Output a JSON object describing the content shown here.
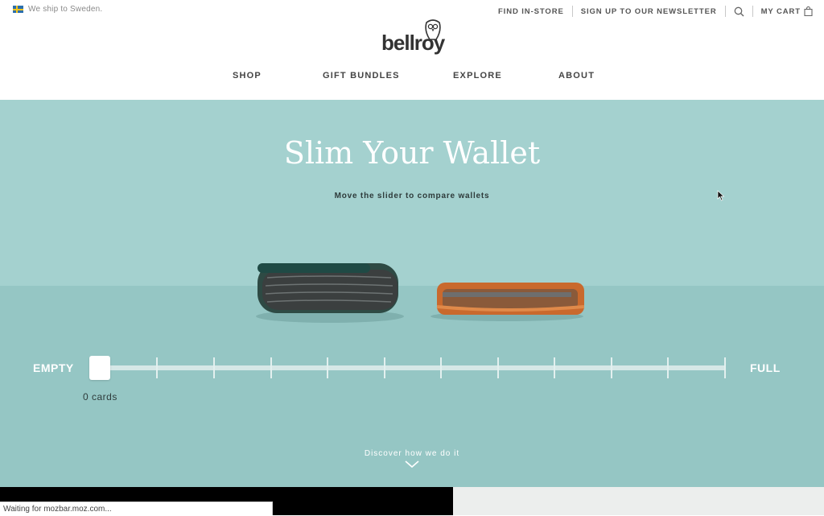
{
  "topbar": {
    "ship_text": "We ship to Sweden.",
    "links": [
      "FIND IN-STORE",
      "SIGN UP TO OUR NEWSLETTER"
    ],
    "cart_label": "MY CART"
  },
  "logo": {
    "text": "bellroy"
  },
  "nav": {
    "items": [
      "SHOP",
      "GIFT BUNDLES",
      "EXPLORE",
      "ABOUT"
    ]
  },
  "hero": {
    "title": "Slim Your Wallet",
    "subtitle": "Move the slider to compare wallets",
    "slider": {
      "min_label": "EMPTY",
      "max_label": "FULL",
      "value": 0,
      "value_label": "0 cards",
      "ticks": 11
    },
    "discover": "Discover how we do it"
  },
  "status_bar": {
    "text": "Waiting for mozbar.moz.com..."
  },
  "colors": {
    "hero_bg": "#95c6c4",
    "hero_top": "#a4d1cf",
    "wallet_left": "#2e4a44",
    "wallet_right": "#c9692d"
  }
}
